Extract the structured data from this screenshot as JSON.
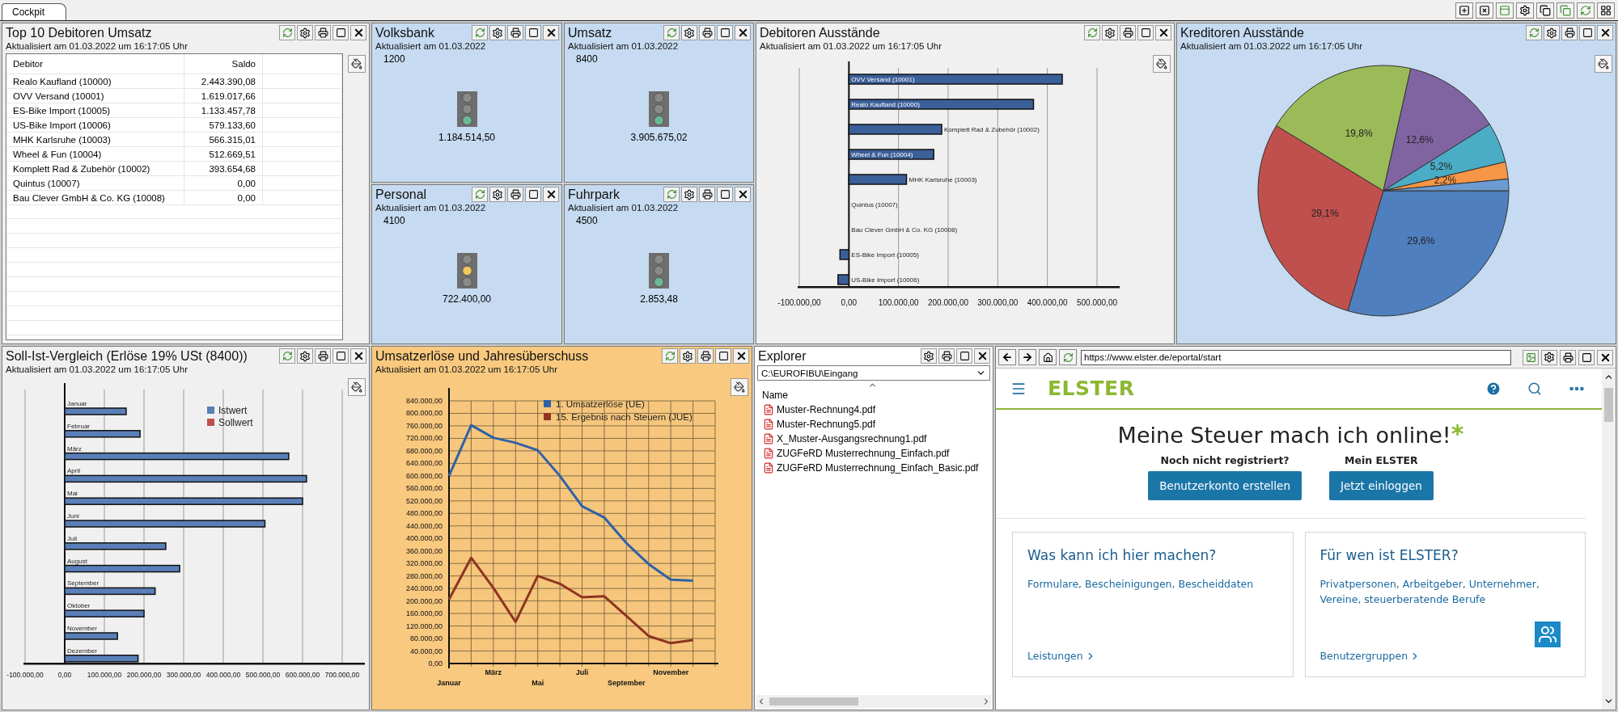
{
  "tabs": [
    {
      "label": "Cockpit",
      "selected": true
    }
  ],
  "top_row": [
    {
      "kind": "table",
      "title": "Top 10 Debitoren Umsatz",
      "subtitle": "Aktualisiert am 01.03.2022 um 16:17:05 Uhr",
      "color": "#f0f0f0",
      "refreshable": true,
      "chart_button": true,
      "columns": [
        "Debitor",
        "Saldo"
      ],
      "rows": [
        {
          "debitor": "Realo Kaufland (10000)",
          "saldo": "2.443.390,08"
        },
        {
          "debitor": "OVV Versand (10001)",
          "saldo": "1.619.017,66"
        },
        {
          "debitor": "ES-Bike Import (10005)",
          "saldo": "1.133.457,78"
        },
        {
          "debitor": "US-Bike Import (10006)",
          "saldo": "579.133,60"
        },
        {
          "debitor": "MHK Karlsruhe (10003)",
          "saldo": "566.315,01"
        },
        {
          "debitor": "Wheel & Fun (10004)",
          "saldo": "512.669,51"
        },
        {
          "debitor": "Komplett Rad & Zubehör (10002)",
          "saldo": "393.654,68"
        },
        {
          "debitor": "Quintus (10007)",
          "saldo": "0,00"
        },
        {
          "debitor": "Bau Clever GmbH & Co. KG (10008)",
          "saldo": "0,00"
        }
      ]
    },
    {
      "kind": "traffic",
      "title": "Volksbank",
      "subtitle": "Aktualisiert am 01.03.2022",
      "color": "#c6dbf1",
      "refreshable": true,
      "chart_button": false,
      "account": "1200",
      "value": "1.184.514,50",
      "red_on": false,
      "yellow_on": false,
      "green_on": true
    },
    {
      "kind": "traffic",
      "title": "Umsatz",
      "subtitle": "Aktualisiert am 01.03.2022",
      "color": "#c6dbf1",
      "refreshable": true,
      "chart_button": false,
      "account": "8400",
      "value": "3.905.675,02",
      "red_on": false,
      "yellow_on": false,
      "green_on": true
    },
    {
      "kind": "chart",
      "title": "Debitoren Ausstände",
      "subtitle": "Aktualisiert am 01.03.2022 um 16:17:05 Uhr",
      "color": "#f0f0f0",
      "refreshable": true,
      "chart_button": true,
      "chart_data": {
        "type": "bar",
        "orientation": "horizontal",
        "grid": true,
        "categories": [
          "OVV Versand (10001)",
          "Realo Kaufland (10000)",
          "Komplett Rad & Zubehör (10002)",
          "Wheel & Fun (10004)",
          "MHK Karlsruhe (10003)",
          "Quintus (10007)",
          "Bau Clever GmbH & Co. KG (10008)",
          "ES-Bike Import (10005)",
          "US-Bike Import (10006)"
        ],
        "series": [
          {
            "color": "#3b5f99",
            "values": [
              430000,
              372000,
              187000,
              171000,
              116000,
              0,
              0,
              -18000,
              -22000
            ]
          }
        ],
        "xlim": [
          -100000,
          500000
        ],
        "xticks": [
          {
            "value": -100000,
            "label": "-100.000,00"
          },
          {
            "value": 0,
            "label": "0,00"
          },
          {
            "value": 100000,
            "label": "100.000,00"
          },
          {
            "value": 200000,
            "label": "200.000,00"
          },
          {
            "value": 300000,
            "label": "300.000,00"
          },
          {
            "value": 400000,
            "label": "400.000,00"
          },
          {
            "value": 500000,
            "label": "500.000,00"
          }
        ]
      }
    },
    {
      "kind": "chart",
      "title": "Kreditoren Ausstände",
      "subtitle": "Aktualisiert am 01.03.2022 um 16:17:05 Uhr",
      "color": "#c6dbf1",
      "refreshable": true,
      "chart_button": true,
      "chart_data": {
        "type": "pie",
        "series": [
          {
            "values": [
              29.6,
              29.1,
              19.8,
              12.6,
              5.2,
              2.2,
              1.5
            ]
          }
        ],
        "value_labels": [
          "29,6%",
          "29,1%",
          "19,8%",
          "12,6%",
          "5,2%",
          "2,2%",
          null
        ]
      }
    },
    {
      "kind": "traffic",
      "title": "Personal",
      "subtitle": "Aktualisiert am 01.03.2022",
      "color": "#c6dbf1",
      "refreshable": true,
      "chart_button": false,
      "account": "4100",
      "value": "722.400,00",
      "red_on": false,
      "yellow_on": true,
      "green_on": false
    },
    {
      "kind": "traffic",
      "title": "Fuhrpark",
      "subtitle": "Aktualisiert am 01.03.2022",
      "color": "#c6dbf1",
      "refreshable": true,
      "chart_button": false,
      "account": "4500",
      "value": "2.853,48",
      "red_on": false,
      "yellow_on": false,
      "green_on": true
    }
  ],
  "bottom_row": [
    {
      "kind": "chart",
      "title": "Soll-Ist-Vergleich (Erlöse 19% USt (8400))",
      "subtitle": "Aktualisiert am 01.03.2022 um 16:17:05 Uhr",
      "color": "#f0f0f0",
      "refreshable": true,
      "chart_button": true,
      "chart_data": {
        "type": "bar",
        "orientation": "horizontal",
        "grid": true,
        "legend": true,
        "categories": [
          "Januar",
          "Februar",
          "März",
          "April",
          "Mai",
          "Juni",
          "Juli",
          "August",
          "September",
          "Oktober",
          "November",
          "Dezember"
        ],
        "series": [
          {
            "name": "Istwert",
            "color": "#5a7fb8",
            "values": [
              155000,
              190000,
              565000,
              610000,
              600000,
              505000,
              255000,
              290000,
              228000,
              200000,
              133000,
              185000
            ]
          },
          {
            "name": "Sollwert",
            "color": "#c0504d",
            "values": [
              null,
              null,
              null,
              null,
              null,
              null,
              null,
              null,
              null,
              null,
              null,
              null
            ]
          }
        ],
        "xlim": [
          -100000,
          700000
        ],
        "xticks": [
          {
            "value": -100000,
            "label": "-100.000,00"
          },
          {
            "value": 0,
            "label": "0,00"
          },
          {
            "value": 100000,
            "label": "100.000,00"
          },
          {
            "value": 200000,
            "label": "200.000,00"
          },
          {
            "value": 300000,
            "label": "300.000,00"
          },
          {
            "value": 400000,
            "label": "400.000,00"
          },
          {
            "value": 500000,
            "label": "500.000,00"
          },
          {
            "value": 600000,
            "label": "600.000,00"
          },
          {
            "value": 700000,
            "label": "700.000,00"
          }
        ]
      }
    },
    {
      "kind": "chart",
      "title": "Umsatzerlöse und Jahresüberschuss",
      "subtitle": "Aktualisiert am 01.03.2022 um 16:17:05 Uhr",
      "color": "#f8c97f",
      "refreshable": true,
      "chart_button": true,
      "chart_data": {
        "type": "line",
        "grid": true,
        "legend": true,
        "categories": [
          "Januar",
          null,
          "März",
          null,
          "Mai",
          null,
          "Juli",
          null,
          "September",
          null,
          "November",
          null
        ],
        "series": [
          {
            "name": "1. Umsatzerlöse (UE)",
            "color": "#2f62a6",
            "values": [
              600000,
              762000,
              722000,
              706000,
              682000,
              600000,
              503000,
              467000,
              385000,
              318000,
              268000,
              265000
            ]
          },
          {
            "name": "15. Ergebnis nach Steuern (JUE)",
            "color": "#8e3420",
            "values": [
              205000,
              338000,
              242000,
              133000,
              280000,
              255000,
              212000,
              215000,
              152000,
              88000,
              65000,
              75000
            ]
          }
        ],
        "ylim": [
          0,
          840000
        ],
        "yticks": [
          {
            "value": 0,
            "label": "0,00"
          },
          {
            "value": 40000,
            "label": "40.000,00"
          },
          {
            "value": 80000,
            "label": "80.000,00"
          },
          {
            "value": 120000,
            "label": "120.000,00"
          },
          {
            "value": 160000,
            "label": "160.000,00"
          },
          {
            "value": 200000,
            "label": "200.000,00"
          },
          {
            "value": 240000,
            "label": "240.000,00"
          },
          {
            "value": 280000,
            "label": "280.000,00"
          },
          {
            "value": 320000,
            "label": "320.000,00"
          },
          {
            "value": 360000,
            "label": "360.000,00"
          },
          {
            "value": 400000,
            "label": "400.000,00"
          },
          {
            "value": 440000,
            "label": "440.000,00"
          },
          {
            "value": 480000,
            "label": "480.000,00"
          },
          {
            "value": 520000,
            "label": "520.000,00"
          },
          {
            "value": 560000,
            "label": "560.000,00"
          },
          {
            "value": 600000,
            "label": "600.000,00"
          },
          {
            "value": 640000,
            "label": "640.000,00"
          },
          {
            "value": 680000,
            "label": "680.000,00"
          },
          {
            "value": 720000,
            "label": "720.000,00"
          },
          {
            "value": 760000,
            "label": "760.000,00"
          },
          {
            "value": 800000,
            "label": "800.000,00"
          },
          {
            "value": 840000,
            "label": "840.000,00"
          }
        ]
      }
    },
    {
      "kind": "explorer",
      "title": "Explorer",
      "color": "#ffffff",
      "refreshable": false,
      "chart_button": false,
      "path": "C:\\EUROFIBU\\Eingang",
      "column": "Name",
      "files": [
        "Muster-Rechnung4.pdf",
        "Muster-Rechnung5.pdf",
        "X_Muster-Ausgangsrechnung1.pdf",
        "ZUGFeRD Musterrechnung_Einfach.pdf",
        "ZUGFeRD Musterrechnung_Einfach_Basic.pdf"
      ]
    },
    {
      "kind": "browser",
      "url": "https://www.elster.de/eportal/start",
      "page": {
        "logo": "ELSTER",
        "heading": "Meine Steuer mach ich online!",
        "heading_mark": "*",
        "actions": [
          {
            "caption": "Noch nicht registriert?",
            "button": "Benutzerkonto erstellen"
          },
          {
            "caption": "Mein ELSTER",
            "button": "Jetzt einloggen"
          }
        ],
        "cards": [
          {
            "title": "Was kann ich hier machen?",
            "text": "Formulare, Bescheinigungen, Bescheiddaten",
            "link": "Leistungen",
            "icon": false
          },
          {
            "title": "Für wen ist ELSTER?",
            "text": "Privatpersonen, Arbeitgeber, Unternehmer, Vereine, steuerberatende Berufe",
            "link": "Benutzergruppen",
            "icon": true
          }
        ]
      }
    }
  ]
}
